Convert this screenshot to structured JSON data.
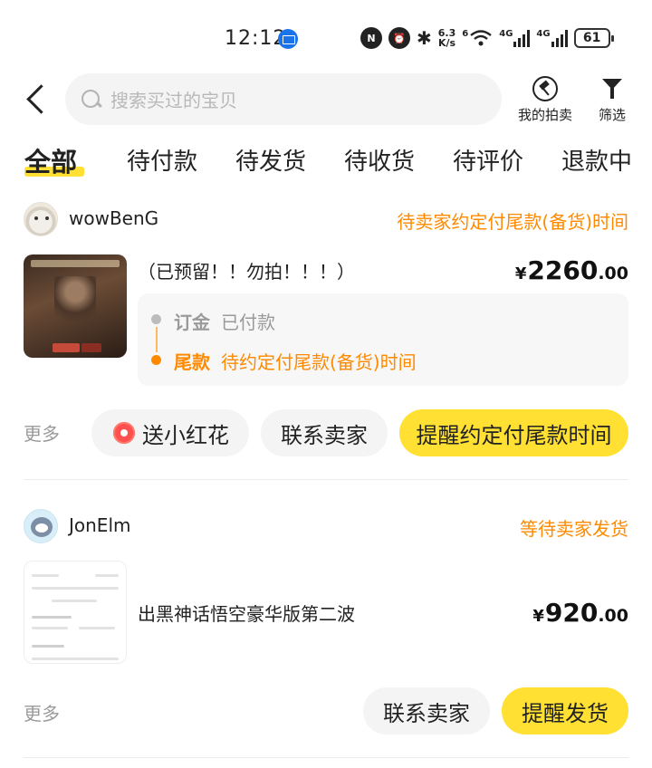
{
  "status_bar": {
    "time": "12:12",
    "mail_icon": "mail-notification-icon",
    "nfc_label": "N",
    "net_speed_value": "6.3",
    "net_speed_unit": "K/s",
    "wifi_sub": "6",
    "sim1_label": "4G",
    "sim2_label": "4G",
    "battery": "61"
  },
  "header": {
    "search_placeholder": "搜索买过的宝贝",
    "my_auction": "我的拍卖",
    "filter": "筛选"
  },
  "tabs": [
    {
      "label": "全部",
      "active": true
    },
    {
      "label": "待付款"
    },
    {
      "label": "待发货"
    },
    {
      "label": "待收货"
    },
    {
      "label": "待评价"
    },
    {
      "label": "退款中"
    }
  ],
  "orders": [
    {
      "seller": "wowBenG",
      "status": "待卖家约定付尾款(备货)时间",
      "title": "（已预留！！勿拍！！！）",
      "price_currency": "¥",
      "price_int": "2260",
      "price_dec": ".00",
      "deposit_label": "订金",
      "deposit_state": "已付款",
      "balance_label": "尾款",
      "balance_state": "待约定付尾款(备货)时间",
      "more": "更多",
      "buttons": [
        "送小红花",
        "联系卖家",
        "提醒约定付尾款时间"
      ]
    },
    {
      "seller": "JonElm",
      "status": "等待卖家发货",
      "title": "出黑神话悟空豪华版第二波",
      "price_currency": "¥",
      "price_int": "920",
      "price_dec": ".00",
      "more": "更多",
      "buttons": [
        "联系卖家",
        "提醒发货"
      ]
    }
  ],
  "colors": {
    "accent_yellow": "#ffe033",
    "status_orange": "#ff8a00",
    "muted_grey": "#9a9a9a"
  }
}
